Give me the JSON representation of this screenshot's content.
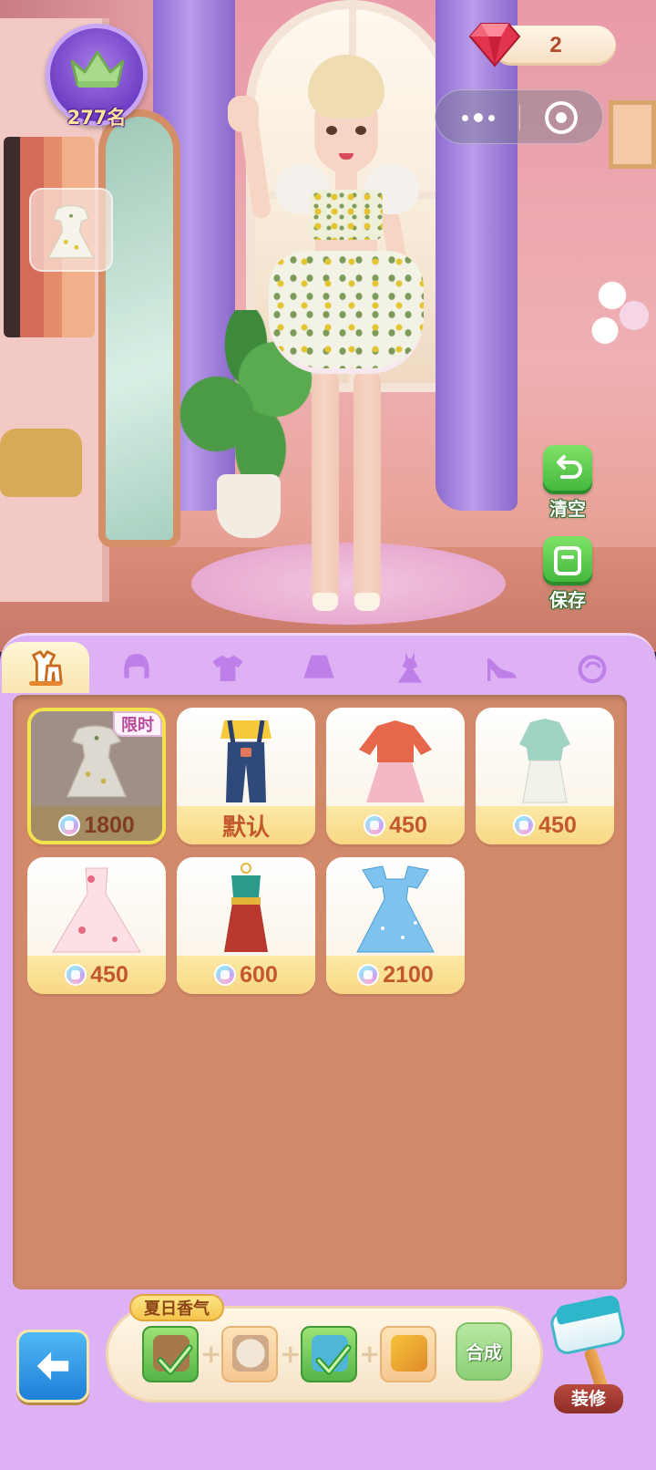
{
  "hud": {
    "rank_text": "277名",
    "gem_count": "2",
    "capsule": {
      "more_icon": "more-dots-icon",
      "close_icon": "target-icon"
    }
  },
  "side_buttons": {
    "clear_label": "清空",
    "save_label": "保存"
  },
  "tabs": [
    {
      "icon": "outfit-icon",
      "active": true
    },
    {
      "icon": "hair-icon",
      "active": false
    },
    {
      "icon": "top-icon",
      "active": false
    },
    {
      "icon": "skirt-icon",
      "active": false
    },
    {
      "icon": "dress-icon",
      "active": false
    },
    {
      "icon": "heels-icon",
      "active": false
    },
    {
      "icon": "accessory-icon",
      "active": false
    }
  ],
  "items": [
    {
      "price": "1800",
      "badge": "限时",
      "selected": true
    },
    {
      "label": "默认"
    },
    {
      "price": "450"
    },
    {
      "price": "450"
    },
    {
      "price": "450"
    },
    {
      "price": "600"
    },
    {
      "price": "2100"
    }
  ],
  "craft": {
    "title": "夏日香气",
    "button_label": "合成",
    "materials": [
      {
        "name": "bag-material-icon",
        "done": true
      },
      {
        "name": "hat-material-icon",
        "done": false
      },
      {
        "name": "gift-material-icon",
        "done": true
      },
      {
        "name": "shoe-material-icon",
        "done": false
      }
    ]
  },
  "decorate_label": "装修",
  "colors": {
    "panel": "#ddb1f3",
    "grid": "#d1896a",
    "price_text": "#c2582b",
    "green_button": "#3fb53a",
    "back_button": "#1f7fd8"
  }
}
